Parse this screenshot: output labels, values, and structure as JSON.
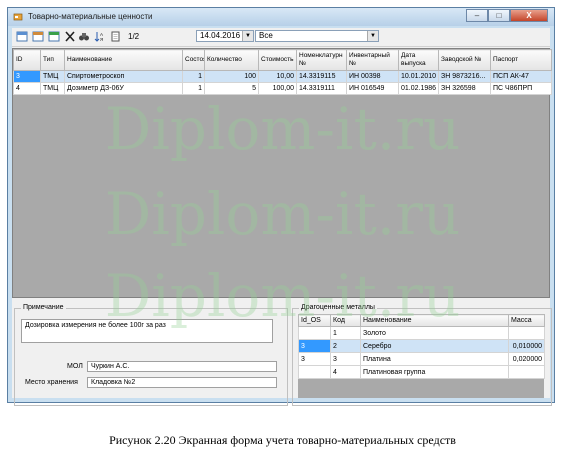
{
  "window": {
    "title": "Товарно-материальные ценности",
    "icon": "app-icon",
    "buttons": [
      "–",
      "□",
      "X"
    ]
  },
  "toolbar": {
    "icons": [
      "add-icon",
      "edit-icon",
      "save-icon",
      "delete-icon",
      "binoculars-icon",
      "sort-icon",
      "copy-icon"
    ],
    "page": "1/2",
    "date_value": "14.04.2016",
    "filter_value": "Все"
  },
  "grid": {
    "columns": [
      "ID",
      "Тип",
      "Наименование",
      "Состоя",
      "Количество",
      "Стоимость",
      "Номенклатурн №",
      "Инвентарный №",
      "Дата выпуска",
      "Заводской №",
      "Паспорт"
    ],
    "rows": [
      [
        "3",
        "ТМЦ",
        "Спиртометроскоп",
        "1",
        "100",
        "10,00",
        "14.3319115",
        "ИН 00398",
        "10.01.2010",
        "ЗН 9873216...",
        "ПСП АК-47"
      ],
      [
        "4",
        "ТМЦ",
        "Дозиметр ДЗ-06У",
        "1",
        "5",
        "100,00",
        "14.3319111",
        "ИН 016549",
        "01.02.1986",
        "ЗН 326598",
        "ПС Ч86ПРП"
      ]
    ]
  },
  "notes": {
    "label": "Примечание",
    "text": "Дозировка измерения не более 100г за раз"
  },
  "mol": {
    "label": "МОЛ",
    "value": "Чуркин А.С."
  },
  "storage": {
    "label": "Место хранения",
    "value": "Кладовка №2"
  },
  "metals": {
    "label": "Драгоценные металлы",
    "columns": [
      "Id_OS",
      "Код",
      "Наименование",
      "Масса"
    ],
    "rows": [
      [
        "",
        "1",
        "Золото",
        ""
      ],
      [
        "3",
        "2",
        "Серебро",
        "0,010000"
      ],
      [
        "3",
        "3",
        "Платина",
        "0,020000"
      ],
      [
        "",
        "4",
        "Платиновая группа",
        ""
      ]
    ]
  },
  "watermark": "Diplom-it.ru",
  "caption": "Рисунок 2.20 Экранная форма учета товарно-материальных средств"
}
